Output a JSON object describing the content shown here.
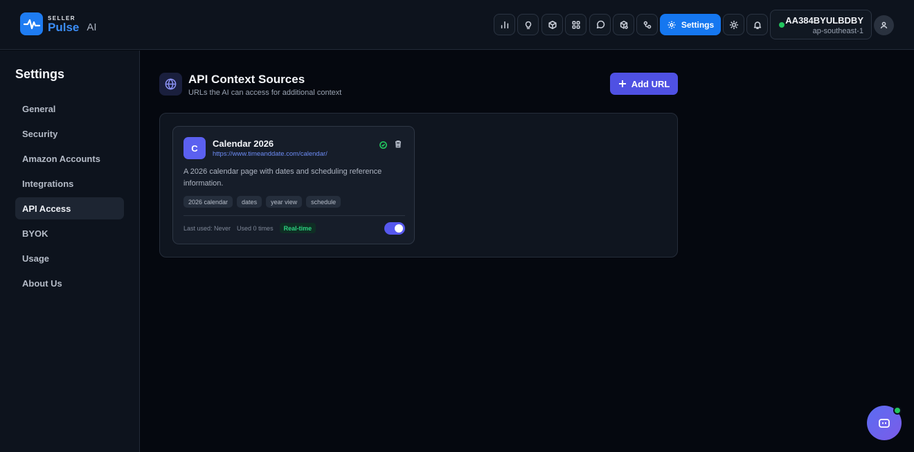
{
  "header": {
    "logo_top": "SELLER",
    "logo_bottom": "Pulse",
    "logo_suffix": "AI",
    "nav_icons": [
      "bar-chart-icon",
      "lightbulb-icon",
      "box-icon",
      "grid-icon",
      "chat-bubble-icon",
      "package-search-icon",
      "workflow-icon"
    ],
    "settings_label": "Settings",
    "account_id": "AA384BYULBDBY",
    "account_region": "ap-southeast-1",
    "account_status_color": "#22c55e"
  },
  "sidebar": {
    "title": "Settings",
    "items": [
      {
        "label": "General",
        "active": false
      },
      {
        "label": "Security",
        "active": false
      },
      {
        "label": "Amazon Accounts",
        "active": false
      },
      {
        "label": "Integrations",
        "active": false
      },
      {
        "label": "API Access",
        "active": true
      },
      {
        "label": "BYOK",
        "active": false
      },
      {
        "label": "Usage",
        "active": false
      },
      {
        "label": "About Us",
        "active": false
      }
    ]
  },
  "main": {
    "title": "API Context Sources",
    "subtitle": "URLs the AI can access for additional context",
    "add_button_label": "Add URL",
    "sources": [
      {
        "initial": "C",
        "name": "Calendar 2026",
        "url": "https://www.timeanddate.com/calendar/",
        "description": "A 2026 calendar page with dates and scheduling reference information.",
        "tags": [
          "2026 calendar",
          "dates",
          "year view",
          "schedule"
        ],
        "last_used": "Last used: Never",
        "usage_count": "Used 0 times",
        "mode_badge": "Real-time",
        "enabled": true
      }
    ]
  },
  "colors": {
    "brand": "#1577f0",
    "accent": "#4f51e3",
    "success": "#22c55e"
  }
}
